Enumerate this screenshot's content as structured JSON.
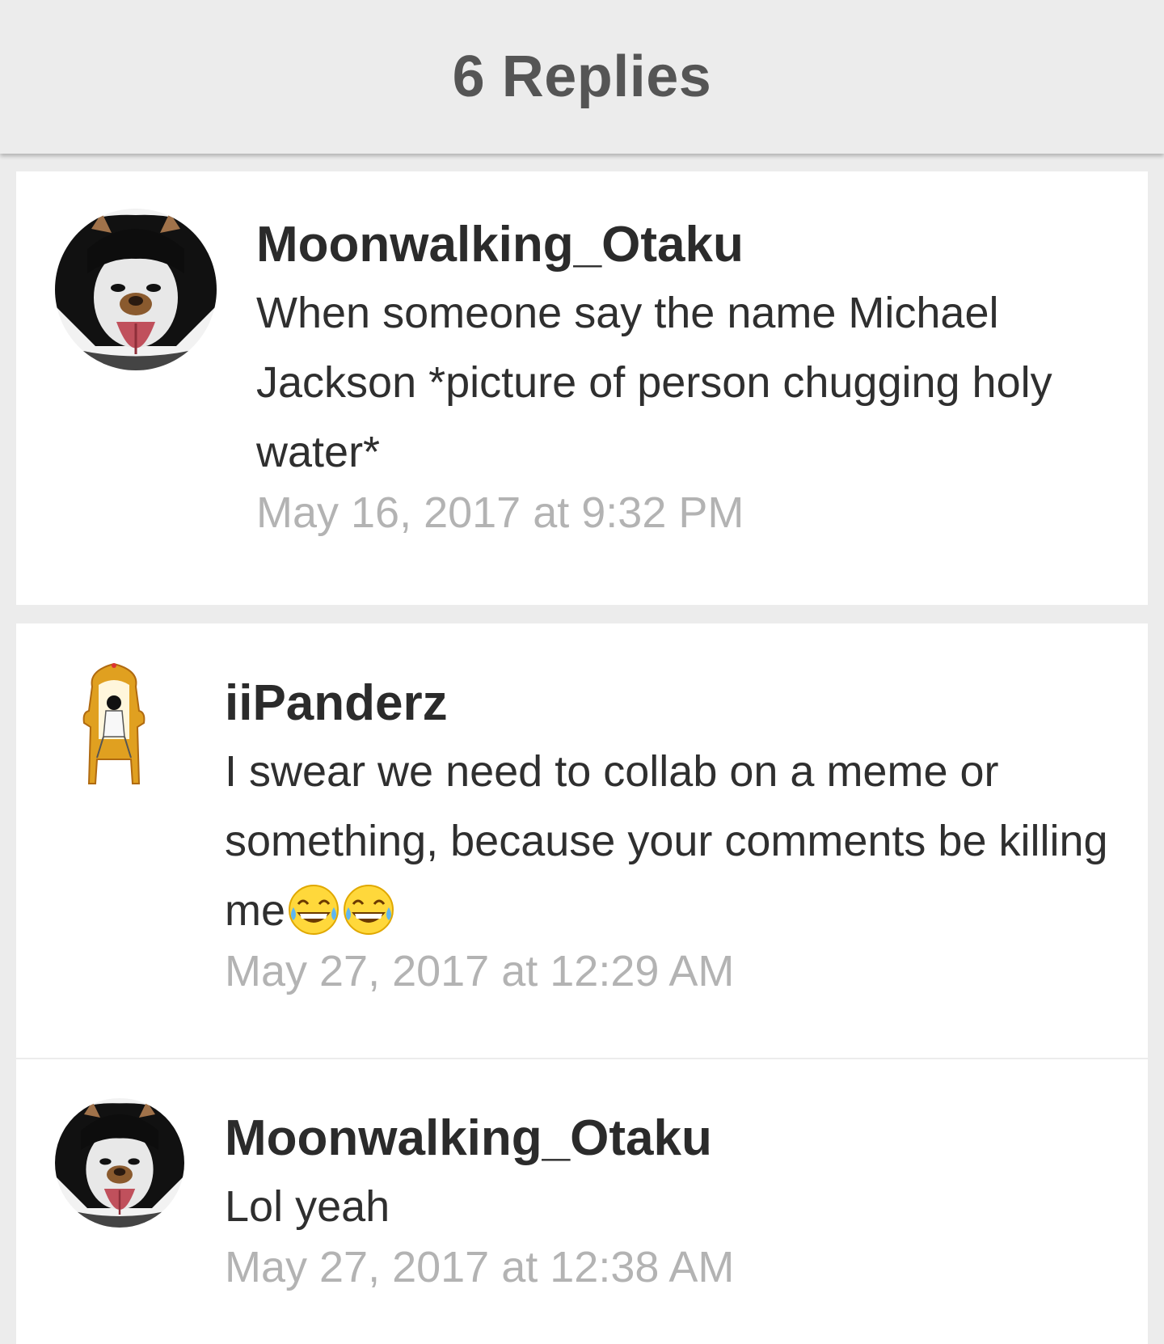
{
  "header": {
    "title": "6 Replies"
  },
  "replies": [
    {
      "username": "Moonwalking_Otaku",
      "message": "When someone say the name Michael Jackson *picture of person chugging holy water*",
      "timestamp": "May 16, 2017 at 9:32 PM",
      "avatar_icon": "dog-filter-portrait-avatar"
    },
    {
      "username": "iiPanderz",
      "message": "I swear we need to collab on a meme or something, because your comments be killing me",
      "emojis": [
        "face-with-tears-of-joy-icon",
        "face-with-tears-of-joy-icon"
      ],
      "timestamp": "May 27, 2017 at 12:29 AM",
      "avatar_icon": "throne-figure-avatar"
    },
    {
      "username": "Moonwalking_Otaku",
      "message": "Lol yeah",
      "timestamp": "May 27, 2017 at 12:38 AM",
      "avatar_icon": "dog-filter-portrait-avatar"
    }
  ]
}
